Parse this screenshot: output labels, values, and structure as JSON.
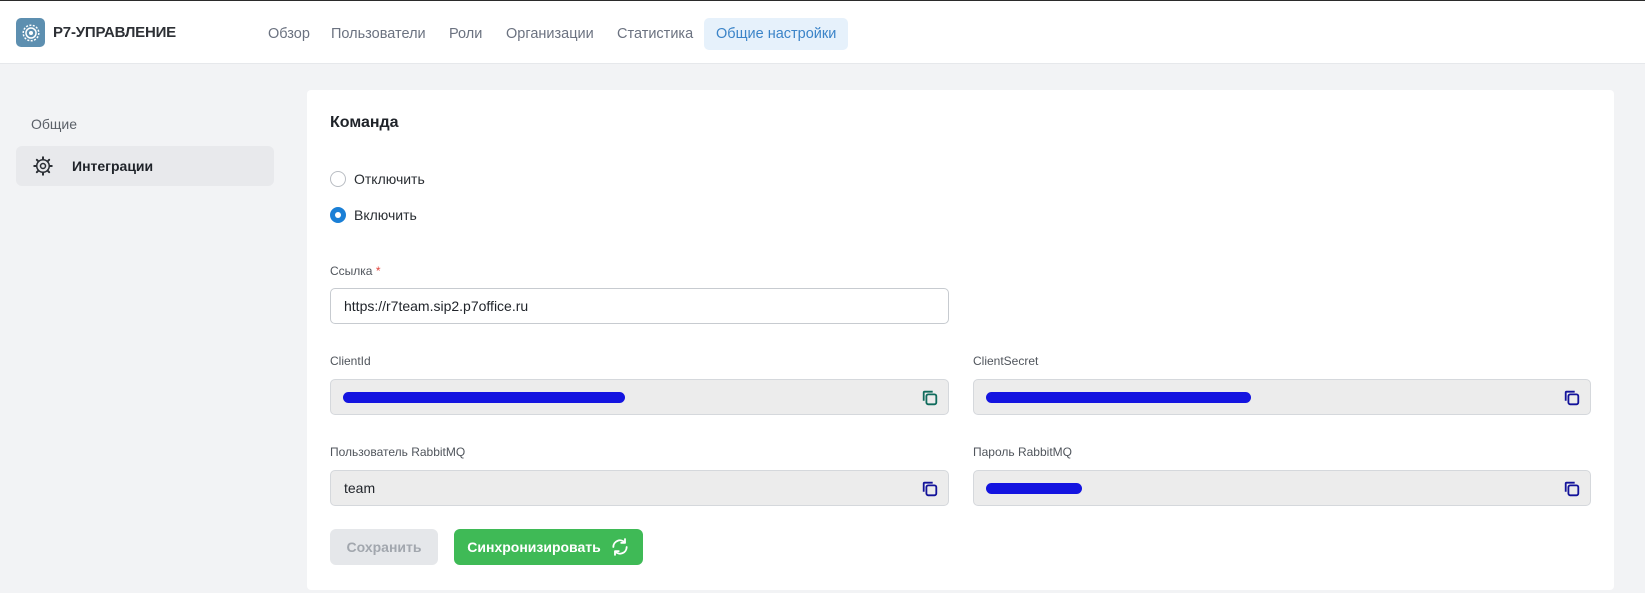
{
  "header": {
    "brand": "Р7-УПРАВЛЕНИЕ",
    "nav": [
      {
        "label": "Обзор"
      },
      {
        "label": "Пользователи"
      },
      {
        "label": "Роли"
      },
      {
        "label": "Организации"
      },
      {
        "label": "Статистика"
      },
      {
        "label": "Общие настройки",
        "active": true
      }
    ]
  },
  "sidebar": {
    "section_title": "Общие",
    "items": [
      {
        "label": "Интеграции",
        "icon": "gear-icon"
      }
    ]
  },
  "main": {
    "title": "Команда",
    "radio_options": [
      {
        "label": "Отключить",
        "checked": false
      },
      {
        "label": "Включить",
        "checked": true
      }
    ],
    "link": {
      "label": "Ссылка",
      "required_mark": "*",
      "value": "https://r7team.sip2.p7office.ru"
    },
    "client_id": {
      "label": "ClientId",
      "value": ""
    },
    "client_secret": {
      "label": "ClientSecret",
      "value": ""
    },
    "rabbit_user": {
      "label": "Пользователь RabbitMQ",
      "value": "team"
    },
    "rabbit_password": {
      "label": "Пароль RabbitMQ",
      "value": ""
    },
    "buttons": {
      "save": "Сохранить",
      "sync": "Синхронизировать"
    }
  },
  "colors": {
    "accent": "#3b84c8",
    "primary_button": "#3fba56",
    "radio_checked": "#1a7fd6",
    "redaction": "#1414e0"
  }
}
